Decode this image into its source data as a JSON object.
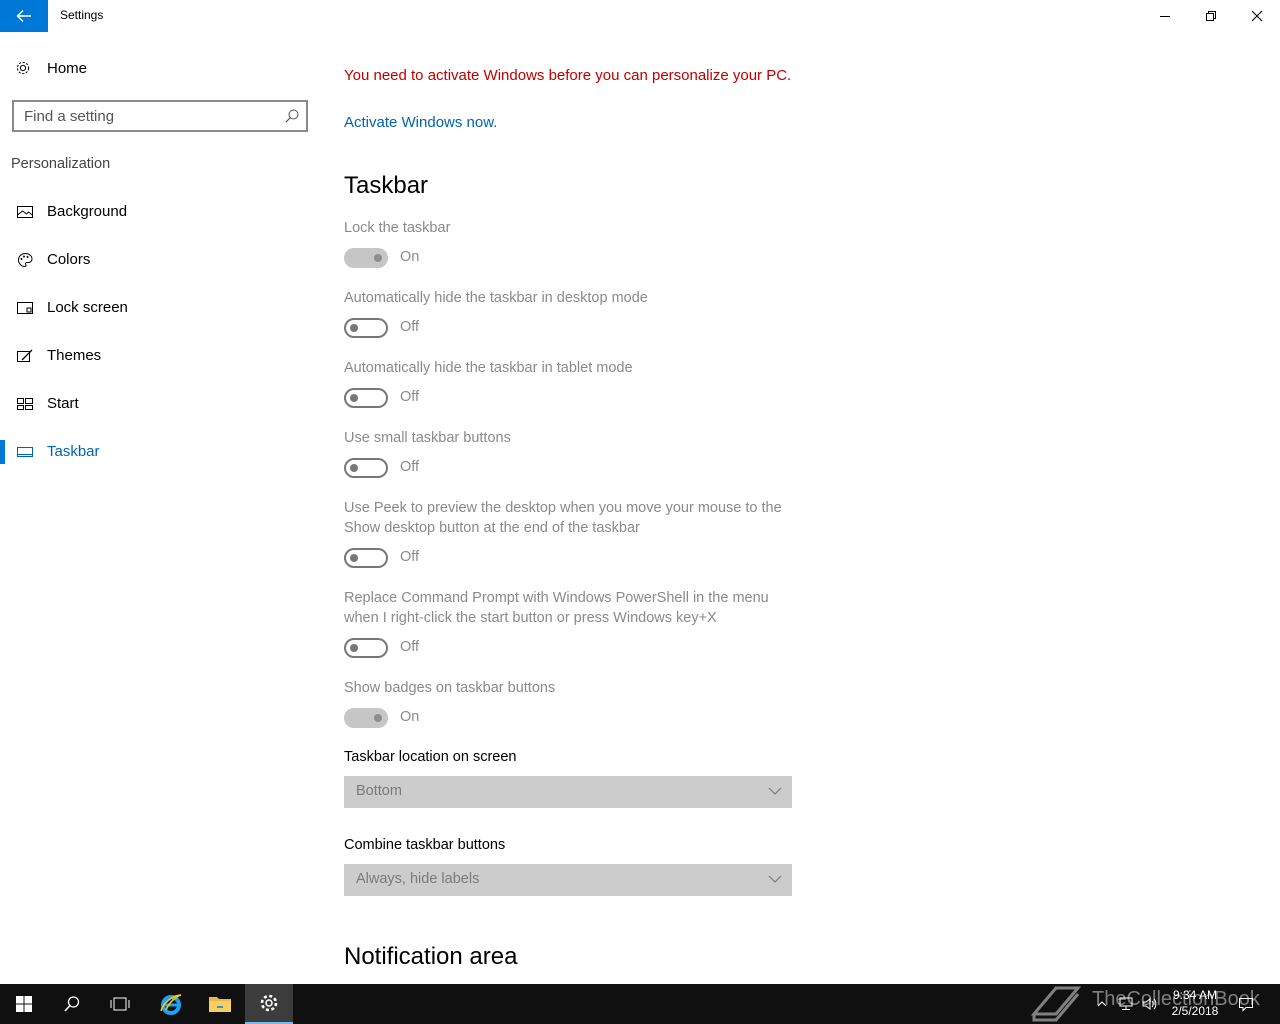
{
  "window": {
    "title": "Settings"
  },
  "sidebar": {
    "home_label": "Home",
    "search_placeholder": "Find a setting",
    "section": "Personalization",
    "items": [
      {
        "label": "Background",
        "icon": "image-icon"
      },
      {
        "label": "Colors",
        "icon": "palette-icon"
      },
      {
        "label": "Lock screen",
        "icon": "lock-screen-icon"
      },
      {
        "label": "Themes",
        "icon": "brush-icon"
      },
      {
        "label": "Start",
        "icon": "start-tiles-icon"
      },
      {
        "label": "Taskbar",
        "icon": "taskbar-icon",
        "active": true
      }
    ]
  },
  "main": {
    "warning": "You need to activate Windows before you can personalize your PC.",
    "activate_link": "Activate Windows now.",
    "heading": "Taskbar",
    "settings": [
      {
        "label": "Lock the taskbar",
        "state": "On"
      },
      {
        "label": "Automatically hide the taskbar in desktop mode",
        "state": "Off"
      },
      {
        "label": "Automatically hide the taskbar in tablet mode",
        "state": "Off"
      },
      {
        "label": "Use small taskbar buttons",
        "state": "Off"
      },
      {
        "label": "Use Peek to preview the desktop when you move your mouse to the Show desktop button at the end of the taskbar",
        "state": "Off"
      },
      {
        "label": "Replace Command Prompt with Windows PowerShell in the menu when I right-click the start button or press Windows key+X",
        "state": "Off"
      },
      {
        "label": "Show badges on taskbar buttons",
        "state": "On"
      }
    ],
    "location_label": "Taskbar location on screen",
    "location_value": "Bottom",
    "combine_label": "Combine taskbar buttons",
    "combine_value": "Always, hide labels",
    "notification_heading": "Notification area"
  },
  "taskbar": {
    "time": "9:34 AM",
    "date": "2/5/2018",
    "watermark": "TheCollectionBook",
    "accent": "#0078d7"
  }
}
